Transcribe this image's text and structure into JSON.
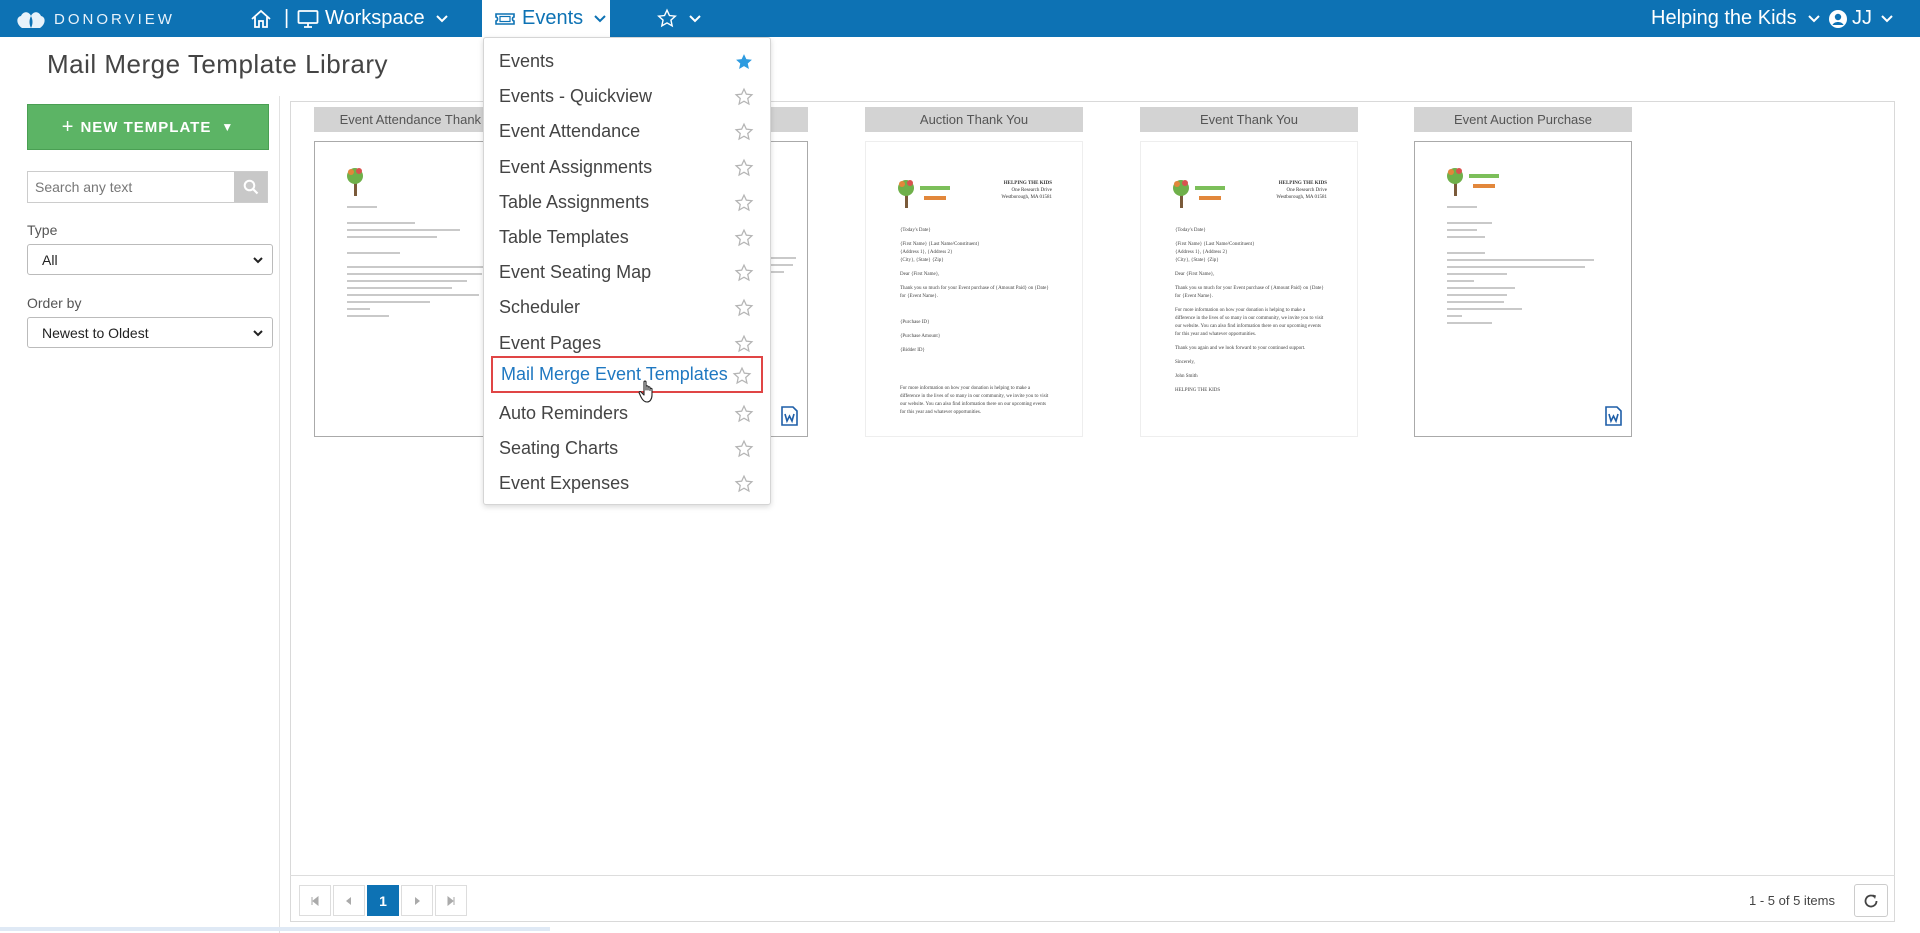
{
  "brand": {
    "name": "DONORVIEW"
  },
  "nav": {
    "separator": "|",
    "workspace": "Workspace",
    "events": "Events",
    "org": "Helping the Kids",
    "user": "JJ"
  },
  "page": {
    "title": "Mail Merge Template Library"
  },
  "sidebar": {
    "new_template": "NEW TEMPLATE",
    "search_placeholder": "Search any text",
    "type_label": "Type",
    "type_value": "All",
    "order_label": "Order by",
    "order_value": "Newest to Oldest"
  },
  "events_menu": {
    "items": [
      {
        "label": "Events",
        "favorite": true
      },
      {
        "label": "Events - Quickview",
        "favorite": false
      },
      {
        "label": "Event Attendance",
        "favorite": false
      },
      {
        "label": "Event Assignments",
        "favorite": false
      },
      {
        "label": "Table Assignments",
        "favorite": false
      },
      {
        "label": "Table Templates",
        "favorite": false
      },
      {
        "label": "Event Seating Map",
        "favorite": false
      },
      {
        "label": "Scheduler",
        "favorite": false
      },
      {
        "label": "Event Pages",
        "favorite": false
      },
      {
        "label": "Mail Merge Event Templates",
        "favorite": false,
        "hovered": true
      },
      {
        "label": "Auto Reminders",
        "favorite": false
      },
      {
        "label": "Seating Charts",
        "favorite": false
      },
      {
        "label": "Event Expenses",
        "favorite": false
      }
    ]
  },
  "templates": [
    {
      "title": "Event Attendance Thank You"
    },
    {
      "title": ""
    },
    {
      "title": "Auction Thank You"
    },
    {
      "title": "Event Thank You"
    },
    {
      "title": "Event Auction Purchase"
    }
  ],
  "doc_text": {
    "org_name": "HELPING THE KIDS",
    "address1": "One Research Drive",
    "address2": "Westborough, MA 01581",
    "date": "{Today's Date}",
    "name_line": "{First Name} {Last Name/Constituent}",
    "addr_line": "{Address 1}, {Address 2}",
    "city_line": "{City}, {State} {Zip}",
    "dear": "Dear {First Name},",
    "auction_thanks": "Thank you so much for your Event purchase of {Amount Paid} on {Date} for {Event Name}.",
    "purchase_id": "{Purchase ID}",
    "purchase_amount": "{Purchase Amount}",
    "bidder_id": "{Bidder ID}",
    "auction_more": "For more information on how your donation is helping to make a difference in the lives of so many in our community, we invite you to visit our website. You can also find information there on our upcoming events for this year and whatever opportunities.",
    "event_thanks": "Thank you so much for your Event purchase of {Amount Paid} on {Date} for {Event Name}.",
    "event_more": "For more information on how your donation is helping to make a difference in the lives of so many in our community, we invite you to visit our website. You can also find information there on our upcoming events for this year and whatever opportunities.",
    "thank_again": "Thank you again and we look forward to your continued support.",
    "sincerely": "Sincerely,",
    "signer": "John Smith",
    "org_footer": "HELPING THE KIDS"
  },
  "pager": {
    "current_page": "1",
    "info": "1 - 5 of 5 items"
  },
  "colors": {
    "topbar": "#0d72b4",
    "new_button": "#5cb465",
    "highlight_border": "#e04545",
    "star_active": "#2d9be0"
  }
}
